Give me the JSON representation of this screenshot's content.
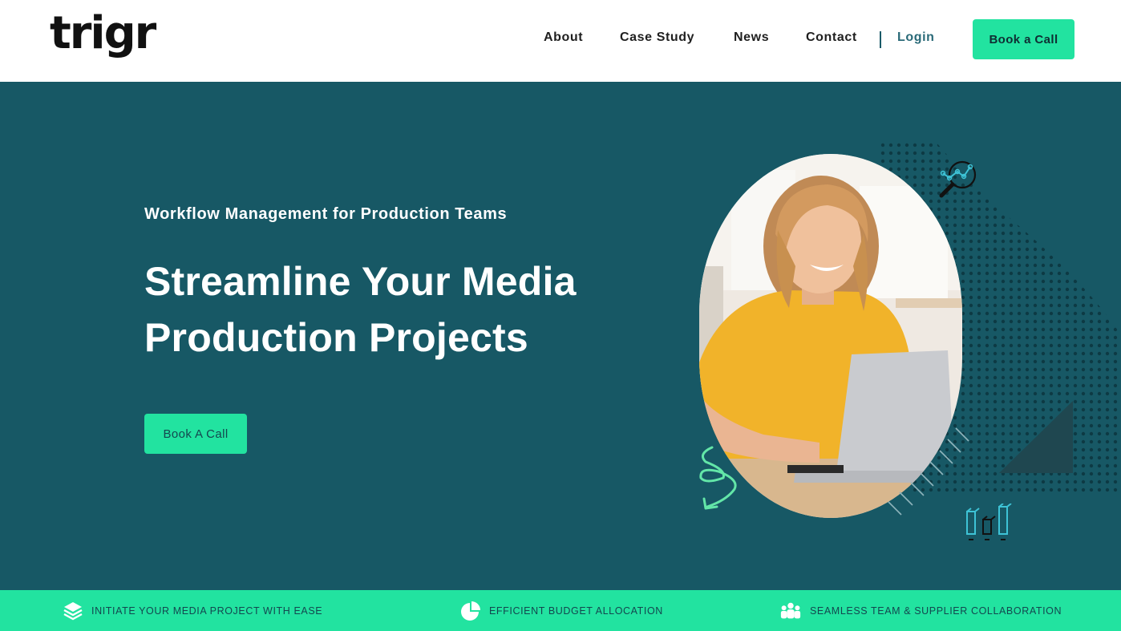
{
  "brand": {
    "logo_text": "trigr"
  },
  "nav": {
    "items": [
      {
        "label": "About"
      },
      {
        "label": "Case Study"
      },
      {
        "label": "News"
      },
      {
        "label": "Contact"
      }
    ],
    "login_label": "Login",
    "cta_label": "Book a Call"
  },
  "hero": {
    "eyebrow": "Workflow Management for Production Teams",
    "headline": "Streamline Your Media Production Projects",
    "cta_label": "Book A Call"
  },
  "features": [
    {
      "label": "INITIATE YOUR MEDIA PROJECT WITH EASE",
      "icon": "layers-icon"
    },
    {
      "label": "EFFICIENT BUDGET ALLOCATION",
      "icon": "pie-chart-icon"
    },
    {
      "label": "SEAMLESS TEAM & SUPPLIER COLLABORATION",
      "icon": "team-icon"
    }
  ],
  "colors": {
    "hero_background": "#175865",
    "accent": "#22e3a0",
    "text_dark": "#1f1f1f",
    "login_text": "#2a6a78"
  }
}
